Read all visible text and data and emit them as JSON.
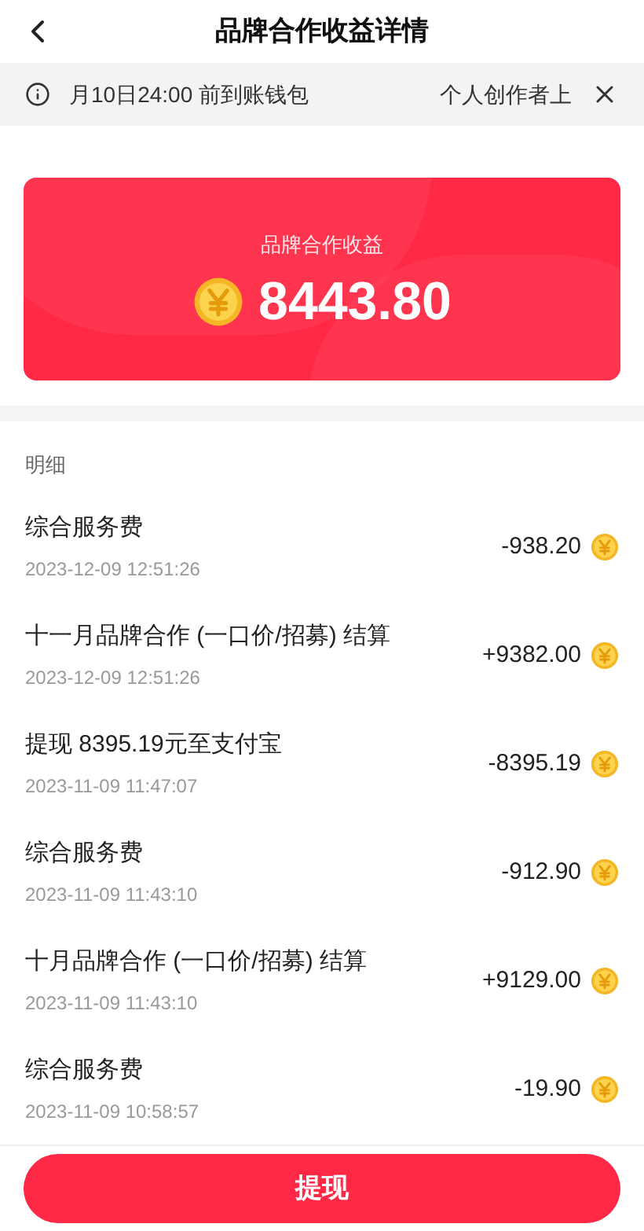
{
  "header": {
    "title": "品牌合作收益详情"
  },
  "notice": {
    "texts": [
      "月10日24:00 前到账钱包",
      "个人创作者上"
    ]
  },
  "summary": {
    "label": "品牌合作收益",
    "amount": "8443.80"
  },
  "details": {
    "title": "明细",
    "rows": [
      {
        "title": "综合服务费",
        "time": "2023-12-09 12:51:26",
        "amount": "-938.20"
      },
      {
        "title": "十一月品牌合作 (一口价/招募) 结算",
        "time": "2023-12-09 12:51:26",
        "amount": "+9382.00"
      },
      {
        "title": "提现 8395.19元至支付宝",
        "time": "2023-11-09 11:47:07",
        "amount": "-8395.19"
      },
      {
        "title": "综合服务费",
        "time": "2023-11-09 11:43:10",
        "amount": "-912.90"
      },
      {
        "title": "十月品牌合作 (一口价/招募) 结算",
        "time": "2023-11-09 11:43:10",
        "amount": "+9129.00"
      },
      {
        "title": "综合服务费",
        "time": "2023-11-09 10:58:57",
        "amount": "-19.90"
      }
    ]
  },
  "withdraw_button": "提现"
}
